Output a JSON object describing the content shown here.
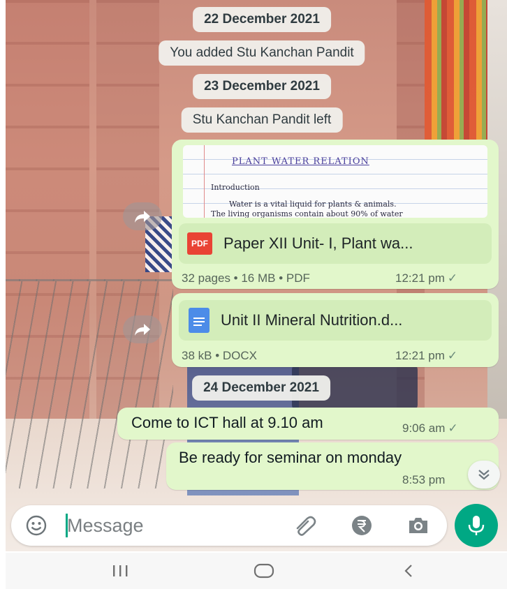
{
  "chat": {
    "dates": [
      "22 December 2021",
      "23 December 2021",
      "24 December 2021"
    ],
    "system_messages": [
      "You added Stu Kanchan Pandit",
      "Stu Kanchan Pandit left"
    ],
    "pdf_message": {
      "preview_title": "PLANT WATER RELATION",
      "preview_lines": [
        "Introduction",
        "Water is a vital liquid for plants & animals.",
        "The living organisms contain about 90% of water"
      ],
      "icon_label": "PDF",
      "file_name": "Paper XII Unit- I, Plant wa...",
      "meta": "32 pages • 16 MB • PDF",
      "time": "12:21 pm",
      "tick": "✓"
    },
    "docx_message": {
      "file_name": "Unit II Mineral Nutrition.d...",
      "meta": "38 kB • DOCX",
      "time": "12:21 pm",
      "tick": "✓"
    },
    "text_messages": [
      {
        "text": "Come to ICT hall at 9.10 am",
        "time": "9:06 am",
        "tick": "✓"
      },
      {
        "text": "Be ready for seminar on monday",
        "time": "8:53 pm"
      }
    ]
  },
  "input": {
    "placeholder": "Message"
  },
  "colors": {
    "accent": "#00a884",
    "outgoing_bubble": "#e2f7cb",
    "pdf_red": "#e94335",
    "docx_blue": "#4c8ce8"
  },
  "icons": [
    "forward-icon",
    "emoji-icon",
    "attach-icon",
    "rupee-icon",
    "camera-icon",
    "mic-icon",
    "scroll-down-icon",
    "recents-icon",
    "home-icon",
    "back-icon"
  ]
}
